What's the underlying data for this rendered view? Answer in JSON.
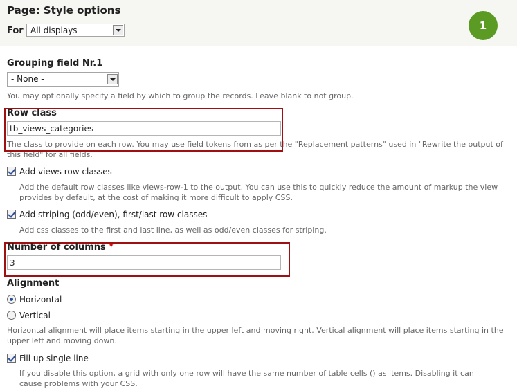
{
  "header": {
    "title": "Page: Style options",
    "for_label": "For",
    "for_select_value": "All displays",
    "badge": "1"
  },
  "grouping": {
    "label": "Grouping field Nr.1",
    "select_value": "- None -",
    "description": "You may optionally specify a field by which to group the records. Leave blank to not group."
  },
  "row_class": {
    "label": "Row class",
    "value": "tb_views_categories",
    "description": "The class to provide on each row. You may use field tokens from as per the \"Replacement patterns\" used in \"Rewrite the output of this field\" for all fields."
  },
  "views_row_classes": {
    "label": "Add views row classes",
    "checked": true,
    "description": "Add the default row classes like views-row-1 to the output. You can use this to quickly reduce the amount of markup the view provides by default, at the cost of making it more difficult to apply CSS."
  },
  "striping": {
    "label": "Add striping (odd/even), first/last row classes",
    "checked": true,
    "description": "Add css classes to the first and last line, as well as odd/even classes for striping."
  },
  "columns": {
    "label": "Number of columns",
    "required_marker": "*",
    "value": "3"
  },
  "alignment": {
    "label": "Alignment",
    "options": [
      "Horizontal",
      "Vertical"
    ],
    "selected": "Horizontal",
    "description": "Horizontal alignment will place items starting in the upper left and moving right. Vertical alignment will place items starting in the upper left and moving down."
  },
  "fill_single_line": {
    "label": "Fill up single line",
    "checked": true,
    "description": "If you disable this option, a grid with only one row will have the same number of table cells () as items. Disabling it can cause problems with your CSS."
  },
  "colors": {
    "highlight_border": "#a01010",
    "badge": "#5b9b23",
    "required": "#cc0000"
  }
}
